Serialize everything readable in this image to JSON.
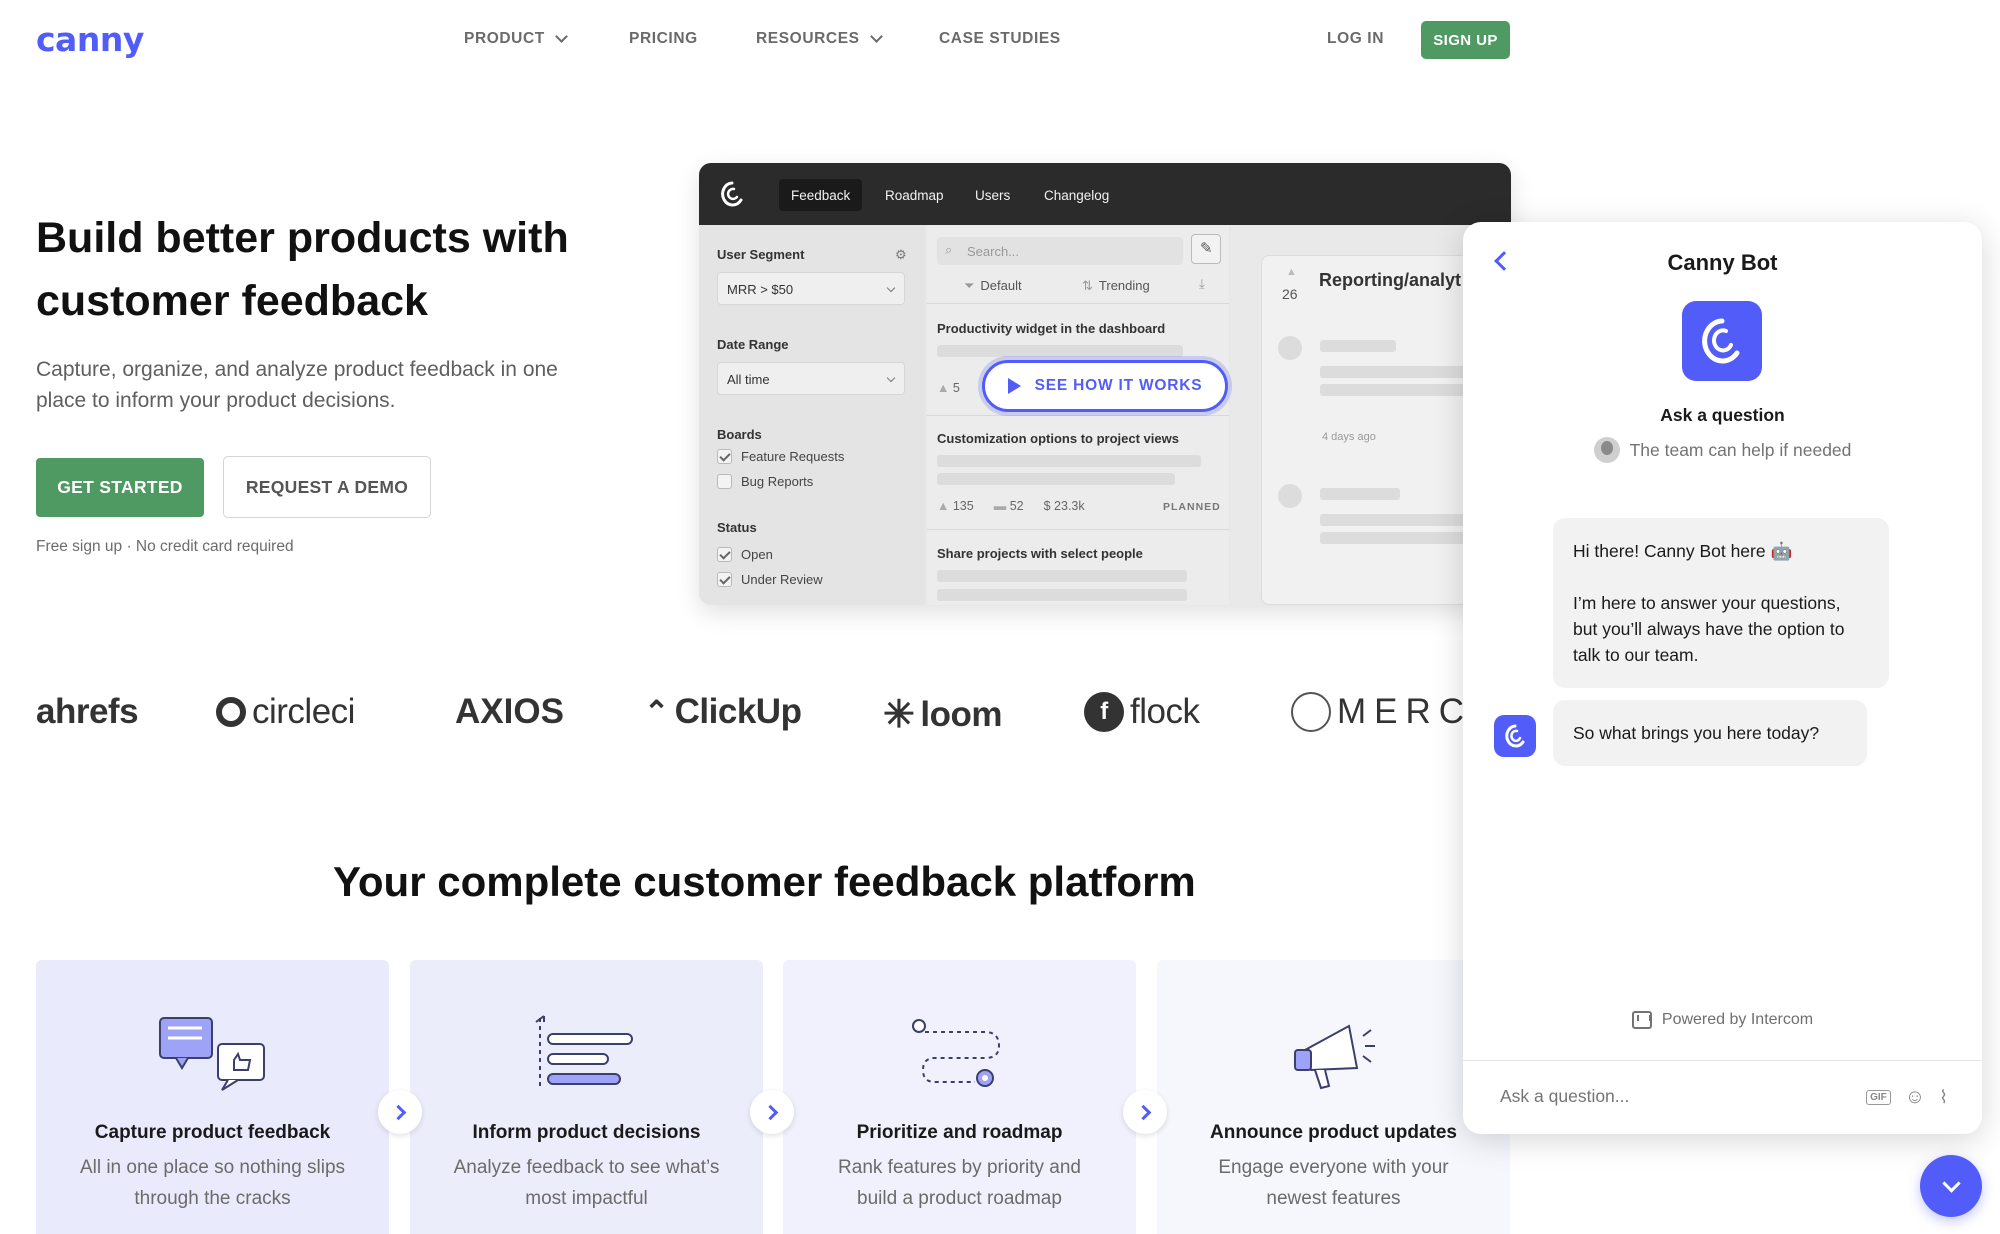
{
  "header": {
    "logo": "canny",
    "nav": [
      {
        "label": "PRODUCT",
        "dropdown": true
      },
      {
        "label": "PRICING",
        "dropdown": false
      },
      {
        "label": "RESOURCES",
        "dropdown": true
      },
      {
        "label": "CASE STUDIES",
        "dropdown": false
      }
    ],
    "login": "LOG IN",
    "signup": "SIGN UP"
  },
  "hero": {
    "title": "Build better products with customer feedback",
    "subtitle": "Capture, organize, and analyze product feedback in one place to inform your product decisions.",
    "cta_primary": "GET STARTED",
    "cta_secondary": "REQUEST A DEMO",
    "note": "Free sign up · No credit card required"
  },
  "mockup": {
    "tabs": [
      "Feedback",
      "Roadmap",
      "Users",
      "Changelog"
    ],
    "active_tab": "Feedback",
    "user_segment_label": "User Segment",
    "user_segment_value": "MRR > $50",
    "date_range_label": "Date Range",
    "date_range_value": "All time",
    "boards_label": "Boards",
    "boards": [
      {
        "label": "Feature Requests",
        "checked": true
      },
      {
        "label": "Bug Reports",
        "checked": false
      }
    ],
    "status_label": "Status",
    "statuses": [
      {
        "label": "Open",
        "checked": true
      },
      {
        "label": "Under Review",
        "checked": true
      }
    ],
    "search_placeholder": "Search...",
    "sort_default": "Default",
    "sort_trending": "Trending",
    "posts": [
      {
        "title": "Productivity widget in the dashboard",
        "votes": "5"
      },
      {
        "title": "Customization options to project views",
        "votes": "135",
        "comments": "52",
        "mrr": "$ 23.3k",
        "status": "PLANNED"
      },
      {
        "title": "Share projects with select people"
      }
    ],
    "detail_votes": "26",
    "detail_title": "Reporting/analyt",
    "detail_time": "4 days ago",
    "see_how": "SEE HOW IT WORKS"
  },
  "logos": [
    "ahrefs",
    "circleci",
    "AXIOS",
    "ClickUp",
    "loom",
    "flock",
    "MERCU"
  ],
  "platform": {
    "title": "Your complete customer feedback platform",
    "features": [
      {
        "title": "Capture product feedback",
        "desc": "All in one place so nothing slips through the cracks",
        "icon": "chat-bubbles-icon"
      },
      {
        "title": "Inform product decisions",
        "desc": "Analyze feedback to see what’s most impactful",
        "icon": "list-bars-icon"
      },
      {
        "title": "Prioritize and roadmap",
        "desc": "Rank features by priority and build a product roadmap",
        "icon": "route-map-icon"
      },
      {
        "title": "Announce product updates",
        "desc": "Engage everyone with your newest features",
        "icon": "megaphone-icon"
      }
    ]
  },
  "chat": {
    "title": "Canny Bot",
    "ask_title": "Ask a question",
    "team_note": "The team can help if needed",
    "message1_line1": "Hi there! Canny Bot here 🤖",
    "message1_line2": "I’m here to answer your questions, but you’ll always have the option to talk to our team.",
    "message2": "So what brings you here today?",
    "powered_by": "Powered by Intercom",
    "input_placeholder": "Ask a question..."
  },
  "colors": {
    "brand": "#525df9",
    "green": "#4f9a63"
  }
}
